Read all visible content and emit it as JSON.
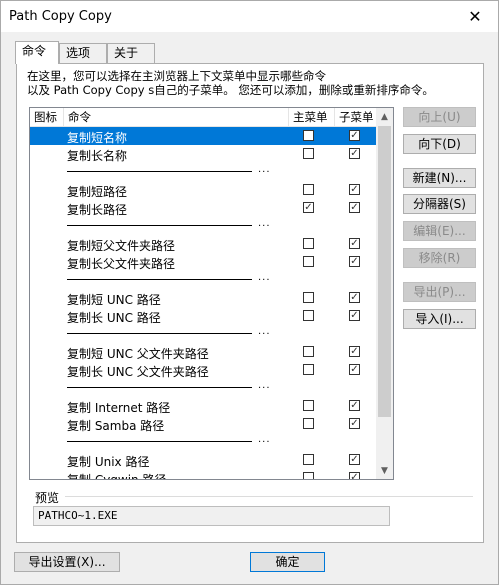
{
  "window": {
    "title": "Path Copy Copy",
    "close_glyph": "✕"
  },
  "tabs": [
    {
      "label": "命令",
      "active": true
    },
    {
      "label": "选项",
      "active": false
    },
    {
      "label": "关于",
      "active": false
    }
  ],
  "description": {
    "line1": "在这里，您可以选择在主浏览器上下文菜单中显示哪些命令",
    "line2": "以及 Path Copy Copy s自己的子菜单。 您还可以添加，删除或重新排序命令。"
  },
  "list": {
    "headers": {
      "icon": "图标",
      "command": "命令",
      "main_menu": "主菜单",
      "submenu": "子菜单"
    },
    "separator_dots": "...",
    "rows": [
      {
        "type": "item",
        "label": "复制短名称",
        "main": false,
        "sub": true,
        "selected": true
      },
      {
        "type": "item",
        "label": "复制长名称",
        "main": false,
        "sub": true
      },
      {
        "type": "sep"
      },
      {
        "type": "item",
        "label": "复制短路径",
        "main": false,
        "sub": true
      },
      {
        "type": "item",
        "label": "复制长路径",
        "main": true,
        "sub": true
      },
      {
        "type": "sep"
      },
      {
        "type": "item",
        "label": "复制短父文件夹路径",
        "main": false,
        "sub": true
      },
      {
        "type": "item",
        "label": "复制长父文件夹路径",
        "main": false,
        "sub": true
      },
      {
        "type": "sep"
      },
      {
        "type": "item",
        "label": "复制短 UNC 路径",
        "main": false,
        "sub": true
      },
      {
        "type": "item",
        "label": "复制长 UNC 路径",
        "main": false,
        "sub": true
      },
      {
        "type": "sep"
      },
      {
        "type": "item",
        "label": "复制短 UNC 父文件夹路径",
        "main": false,
        "sub": true
      },
      {
        "type": "item",
        "label": "复制长 UNC 父文件夹路径",
        "main": false,
        "sub": true
      },
      {
        "type": "sep"
      },
      {
        "type": "item",
        "label": "复制 Internet 路径",
        "main": false,
        "sub": true
      },
      {
        "type": "item",
        "label": "复制 Samba 路径",
        "main": false,
        "sub": true
      },
      {
        "type": "sep"
      },
      {
        "type": "item",
        "label": "复制 Unix 路径",
        "main": false,
        "sub": true
      },
      {
        "type": "item",
        "label": "复制 Cygwin 路径",
        "main": false,
        "sub": true
      }
    ]
  },
  "side_buttons": {
    "move_up": "向上(U)",
    "move_down": "向下(D)",
    "new": "新建(N)...",
    "separator": "分隔器(S)",
    "edit": "编辑(E)...",
    "remove": "移除(R)",
    "export": "导出(P)...",
    "import": "导入(I)..."
  },
  "preview": {
    "label": "预览",
    "value": "PATHCO~1.EXE"
  },
  "bottom": {
    "export_settings": "导出设置(X)...",
    "ok": "确定"
  },
  "colors": {
    "selection": "#0078d7",
    "window_bg": "#f0f0f0"
  }
}
